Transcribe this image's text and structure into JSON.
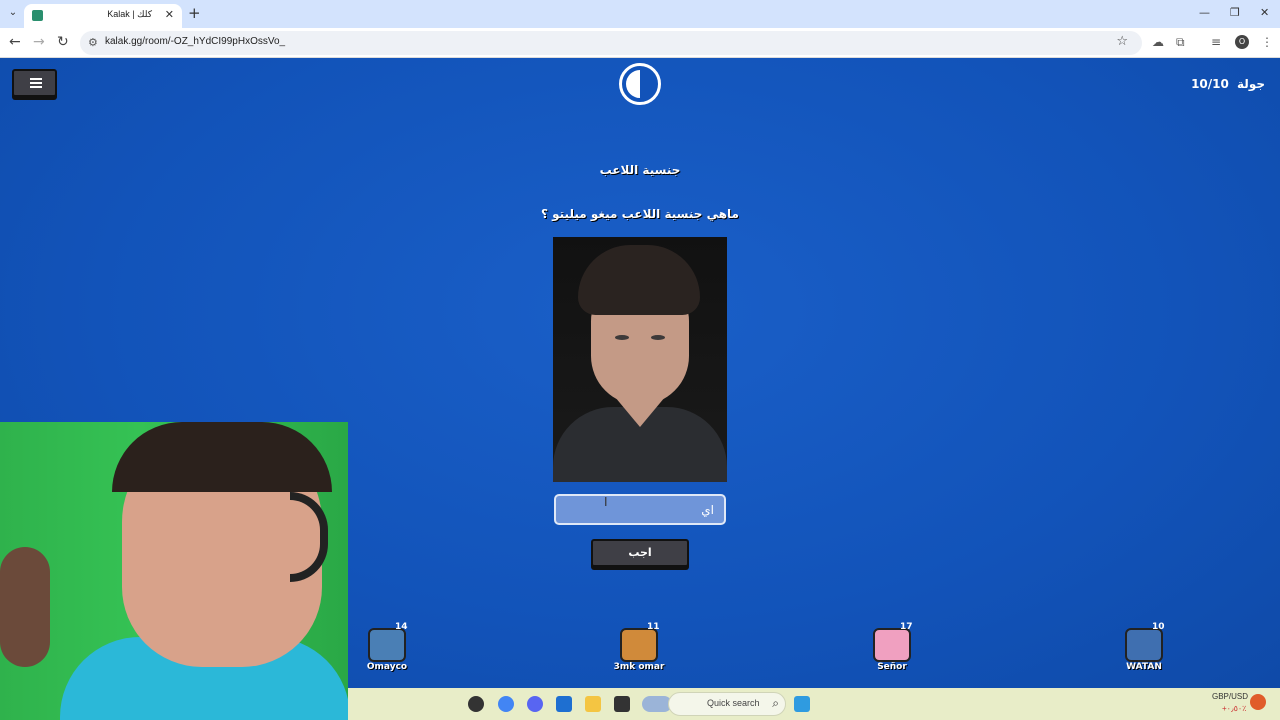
{
  "browser": {
    "tab_title": "Kalak | كلك",
    "url": "kalak.gg/room/-OZ_hYdCI99pHxOssVo_",
    "profile_initial": "O"
  },
  "game": {
    "round_label": "جولة",
    "round_value": "10/10",
    "category": "جنسية اللاعب",
    "question": "ماهي جنسية اللاعب ميغو ميليتو ؟",
    "answer_value": "اي",
    "submit_label": "اجب"
  },
  "players": [
    {
      "name": "Omayco",
      "score": "14",
      "color": "#4a7fb5"
    },
    {
      "name": "3mk omar",
      "score": "11",
      "color": "#d08a3a"
    },
    {
      "name": "Señor",
      "score": "17",
      "color": "#f0a0c0"
    },
    {
      "name": "WATAN",
      "score": "10",
      "color": "#3f6fb0"
    }
  ],
  "taskbar": {
    "search_placeholder": "Quick search",
    "ticker_label": "GBP/USD",
    "ticker_value": "+٠٫٥٠٪"
  },
  "icons": [
    "menu-icon",
    "timer-icon",
    "back-icon",
    "forward-icon",
    "reload-icon",
    "star-icon",
    "extensions-icon",
    "close-icon",
    "search-icon"
  ]
}
